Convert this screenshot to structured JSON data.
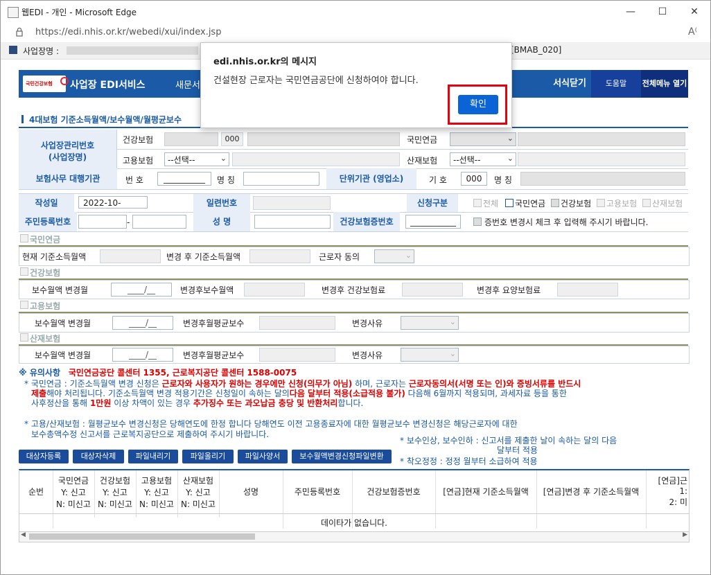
{
  "window": {
    "title": "웹EDI - 개인 - Microsoft Edge",
    "url": "https://edi.nhis.or.kr/webedi/xui/index.jsp"
  },
  "topstrip": {
    "label": "사업장명 :",
    "code": "[BMAB_020]"
  },
  "header": {
    "logo_small": "국민건강보험",
    "service": "사업장 EDI서비스",
    "menu_partial": "새문서",
    "close_form": "서식닫기",
    "help": "도움말",
    "all_menu": "전체메뉴 열기"
  },
  "section_title": "4대보험 기준소득월액/보수월액/월평균보수",
  "form": {
    "biz_label_1": "사업장관리번호",
    "biz_label_2": "(사업장명)",
    "health": "건강보험",
    "health_code": "000",
    "employ": "고용보험",
    "employ_select": "--선택--",
    "pension": "국민연금",
    "industrial": "산재보험",
    "industrial_select": "--선택--",
    "agency_label": "보험사무 대행기관",
    "number_label": "번 호",
    "number_value": "__________",
    "name_label": "명 칭",
    "unit_label": "단위기관 (영업소)",
    "sign_label": "기 호",
    "sign_value": "000",
    "name2_label": "명 칭",
    "written_date_label": "작성일",
    "written_date_value": "2022-10-",
    "serial_label": "일련번호",
    "req_type_label": "신청구분",
    "req_all": "전체",
    "req_pension": "국민연금",
    "req_health": "건강보험",
    "req_employ": "고용보험",
    "req_industrial": "산재보험",
    "rrn_label": "주민등록번호",
    "rrn_dash": "-",
    "person_name_label": "성 명",
    "health_card_label": "건강보험증번호",
    "health_card_value": "___________",
    "change_note": "증번호 변경시 체크 후 입력해 주시기 바랍니다."
  },
  "pension_section": {
    "title": "국민연금",
    "current": "현재 기준소득월액",
    "after": "변경 후 기준소득월액",
    "consent": "근로자 동의"
  },
  "health_section": {
    "title": "건강보험",
    "change_month": "보수월액 변경월",
    "change_month_value": "____/__",
    "after_pay": "변경후보수월액",
    "after_premium": "변경후 건강보험료",
    "after_care": "변경후 요양보험료"
  },
  "employ_section": {
    "title": "고용보험",
    "change_month": "보수월액 변경월",
    "change_month_value": "____/__",
    "after_avg": "변경후월평균보수",
    "reason": "변경사유"
  },
  "industrial_section": {
    "title": "산재보험",
    "change_month": "보수월액 변경월",
    "change_month_value": "____/__",
    "after_avg": "변경후월평균보수",
    "reason": "변경사유"
  },
  "notice": {
    "title": "※ 유의사항",
    "callcenter": "국민연금공단 콜센터 1355, 근로복지공단 콜센터 1588-0075",
    "p1_a": "* 국민연금 : 기준소득월액 변경 신청은",
    "p1_b": "근로자와 사용자가 원하는 경우에만 신청(의무가 아님)",
    "p1_c": "하며, 근로자는",
    "p1_d": "근로자동의서(서명 또는 인)와 증빙서류를 반드시",
    "p2_a": "제출",
    "p2_b": "해야 처리됩니다. 기준소득월액 변경 적용기간은 신청일이 속하는 달의",
    "p2_c": "다음 달부터 적용(소급적용 불가)",
    "p2_d": "다음해 6월까지 적용되며, 과세자료 등을 통한",
    "p3_a": "사후정산을 통해",
    "p3_b": "1만원",
    "p3_c": "이상 차액이 있는 경우",
    "p3_d": "추가징수 또는 과오납금 충당 및 반환처리",
    "p3_e": "합니다.",
    "p4": "* 고용/산재보험 : 월평균보수 변경신청은 당해연도에 한정 합니다 당해연도 이전 고용종료자에 대한 월평균보수 변경신청은 해당근로자에 대한",
    "p5": "보수총액수정 신고서를 근로복지공단으로 제출하여 주시기 바랍니다.",
    "r1": "* 보수인상, 보수인하 : 신고서를 제출한 날이 속하는 달의 다음",
    "r2": "달부터 적용",
    "r3": "* 착오정정 : 정정 월부터 소급하여 적용"
  },
  "buttons": [
    "대상자등록",
    "대상자삭제",
    "파일내리기",
    "파일올리기",
    "파일사양서",
    "보수월액변경신청파일변환"
  ],
  "grid": {
    "headers": [
      {
        "l1": "순번",
        "l2": "",
        "l3": ""
      },
      {
        "l1": "국민연금",
        "l2": "Y: 신고",
        "l3": "N: 미신고"
      },
      {
        "l1": "건강보험",
        "l2": "Y: 신고",
        "l3": "N: 미신고"
      },
      {
        "l1": "고용보험",
        "l2": "Y: 신고",
        "l3": "N: 미신고"
      },
      {
        "l1": "산재보험",
        "l2": "Y: 신고",
        "l3": "N: 미신고"
      },
      {
        "l1": "성명",
        "l2": "",
        "l3": ""
      },
      {
        "l1": "주민등록번호",
        "l2": "",
        "l3": ""
      },
      {
        "l1": "건강보험증번호",
        "l2": "",
        "l3": ""
      },
      {
        "l1": "[연금]현재 기준소득월액",
        "l2": "",
        "l3": ""
      },
      {
        "l1": "[연금]변경 후 기준소득월액",
        "l2": "",
        "l3": ""
      },
      {
        "l1": "[연금]근",
        "l2": "1: ",
        "l3": "2: 미"
      }
    ],
    "empty": "데이타가 없습니다."
  },
  "dialog": {
    "title": "edi.nhis.or.kr의 메시지",
    "message": "건설현장 근로자는 국민연금공단에 신청하여야 합니다.",
    "ok": "확인"
  }
}
